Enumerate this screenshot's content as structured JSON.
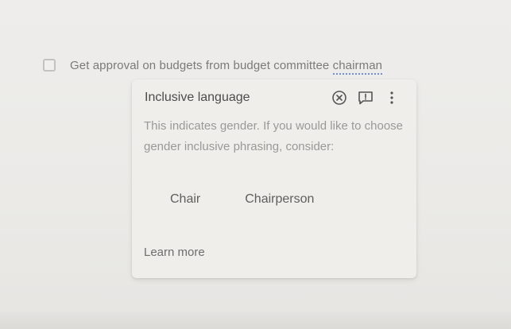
{
  "task": {
    "text_before": "Get approval on budgets from budget committee ",
    "flagged_word": "chairman",
    "checked": false
  },
  "card": {
    "title": "Inclusive language",
    "body": "This indicates gender. If you would like to choose gender inclusive phrasing, consider:",
    "suggestions": [
      "Chair",
      "Chairperson"
    ],
    "learn_more": "Learn more",
    "actions": [
      "dismiss-icon",
      "feedback-icon",
      "more-options-icon"
    ]
  },
  "colors": {
    "flag_underline": "#6f8fd6",
    "icon": "#555453"
  }
}
